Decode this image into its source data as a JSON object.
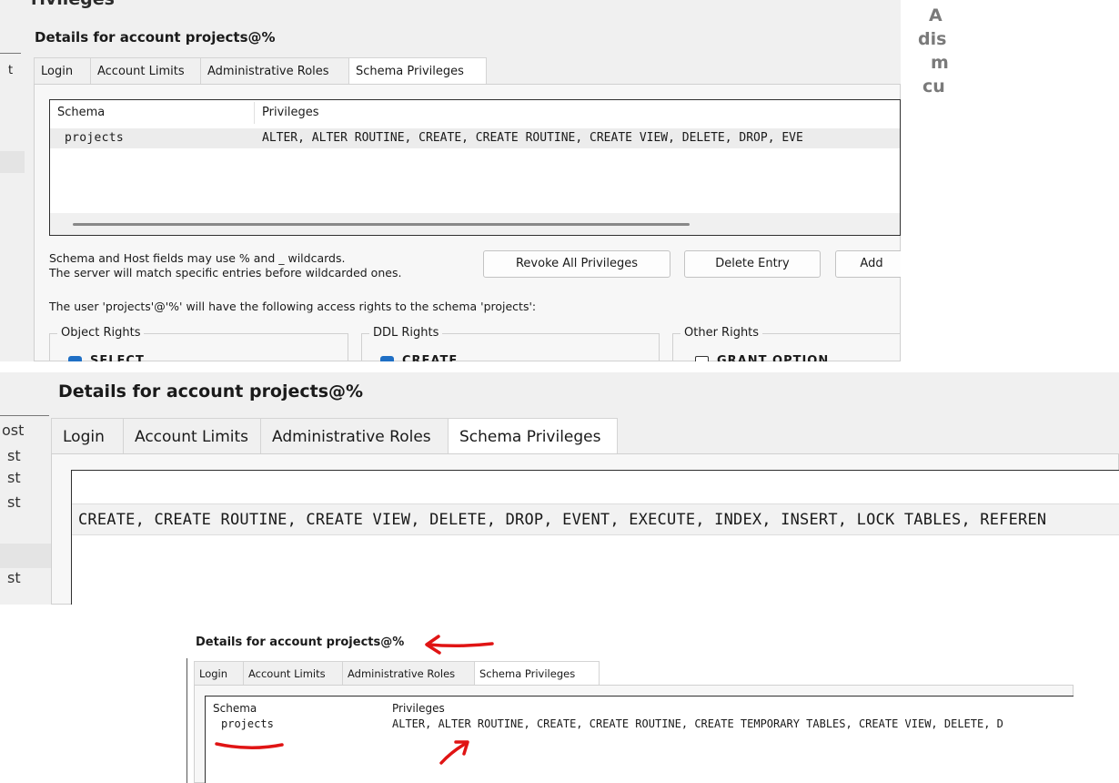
{
  "panel1": {
    "cut_title": "rivileges",
    "left_t": "t",
    "title": "Details for account projects@%",
    "tabs": [
      "Login",
      "Account Limits",
      "Administrative Roles",
      "Schema Privileges"
    ],
    "active_tab": "Schema Privileges",
    "grid": {
      "headers": [
        "Schema",
        "Privileges"
      ],
      "rows": [
        {
          "schema": "projects",
          "privileges": "ALTER, ALTER ROUTINE, CREATE, CREATE ROUTINE, CREATE VIEW, DELETE, DROP, EVE"
        }
      ]
    },
    "hint_line1": "Schema and Host fields may use % and _ wildcards.",
    "hint_line2": "The server will match specific entries before wildcarded ones.",
    "buttons": {
      "revoke": "Revoke All Privileges",
      "delete": "Delete Entry",
      "add": "Add"
    },
    "access_text": "The user 'projects'@'%' will have the following access rights to the schema 'projects':",
    "groups": {
      "object_rights": {
        "label": "Object Rights",
        "first_item": "SELECT"
      },
      "ddl_rights": {
        "label": "DDL Rights",
        "first_item": "CREATE"
      },
      "other_rights": {
        "label": "Other Rights",
        "first_item": "GRANT OPTION"
      }
    }
  },
  "right_cut": [
    "A",
    "dis",
    "m",
    "cu"
  ],
  "panel2": {
    "title": "Details for account projects@%",
    "left_items": [
      "ost",
      "st",
      "st",
      "st",
      "st"
    ],
    "tabs": [
      "Login",
      "Account Limits",
      "Administrative Roles",
      "Schema Privileges"
    ],
    "active_tab": "Schema Privileges",
    "row_privileges": "CREATE, CREATE ROUTINE, CREATE VIEW, DELETE, DROP, EVENT, EXECUTE, INDEX, INSERT, LOCK TABLES, REFEREN"
  },
  "panel3": {
    "title": "Details for account projects@%",
    "tabs": [
      "Login",
      "Account Limits",
      "Administrative Roles",
      "Schema Privileges"
    ],
    "active_tab": "Schema Privileges",
    "grid": {
      "headers": [
        "Schema",
        "Privileges"
      ],
      "rows": [
        {
          "schema": "projects",
          "privileges": "ALTER, ALTER ROUTINE, CREATE, CREATE ROUTINE, CREATE TEMPORARY TABLES, CREATE VIEW, DELETE, D"
        }
      ]
    },
    "annotation_color": "#e01414"
  },
  "colors": {
    "checkbox_on": "#1f6fc5",
    "window_bg": "#f0f0f0",
    "annotation": "#e01414"
  }
}
